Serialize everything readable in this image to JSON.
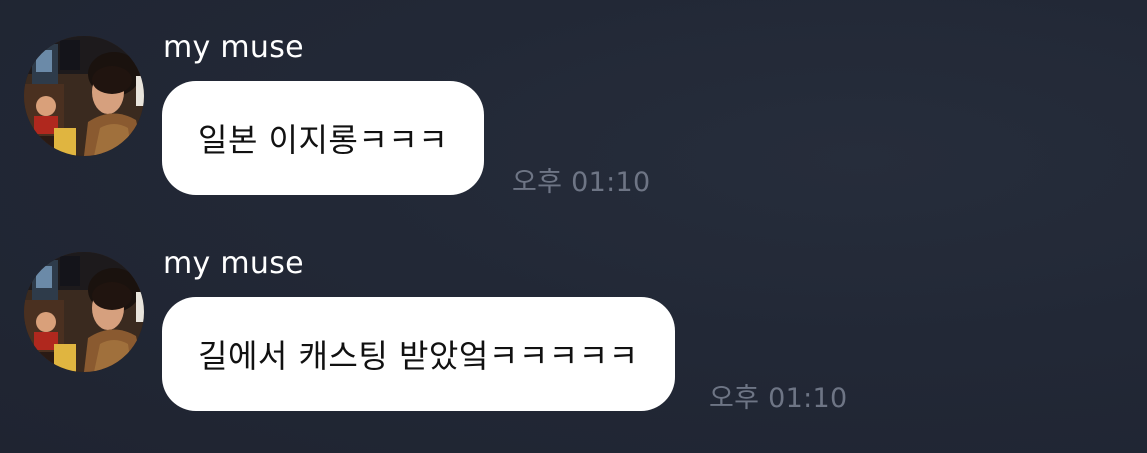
{
  "chat": {
    "messages": [
      {
        "sender": "my muse",
        "text": "일본 이지롱ㅋㅋㅋ",
        "time": "오후 01:10"
      },
      {
        "sender": "my muse",
        "text": "길에서 캐스팅 받았엌ㅋㅋㅋㅋㅋ",
        "time": "오후 01:10"
      }
    ]
  },
  "colors": {
    "background": "#222836",
    "bubble": "#ffffff",
    "bubble_text": "#111111",
    "sender_name": "#ffffff",
    "timestamp": "#6e7585"
  },
  "icons": {
    "avatar": "profile-photo"
  }
}
